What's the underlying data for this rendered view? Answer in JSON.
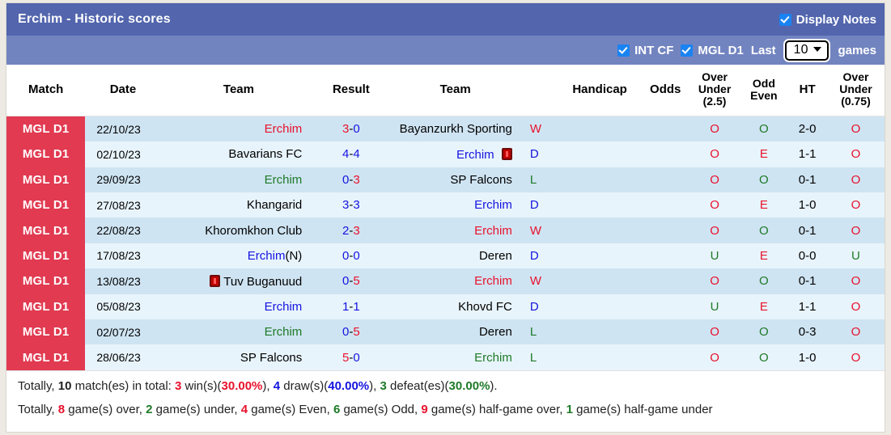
{
  "header": {
    "title": "Erchim - Historic scores",
    "display_notes_label": "Display Notes",
    "display_notes_checked": true,
    "filters": [
      {
        "label": "INT CF",
        "checked": true
      },
      {
        "label": "MGL D1",
        "checked": true
      }
    ],
    "last_label": "Last",
    "games_count": "10",
    "games_label": "games",
    "band_color": "#5265ad",
    "subband_color": "#7284c0",
    "checkbox_color": "#1a83f2"
  },
  "table": {
    "columns": [
      {
        "key": "match",
        "label": "Match"
      },
      {
        "key": "date",
        "label": "Date"
      },
      {
        "key": "home",
        "label": "Team"
      },
      {
        "key": "result",
        "label": "Result"
      },
      {
        "key": "away",
        "label": "Team"
      },
      {
        "key": "wdl",
        "label": ""
      },
      {
        "key": "handicap",
        "label": "Handicap"
      },
      {
        "key": "odds",
        "label": "Odds"
      },
      {
        "key": "ou25",
        "label": "Over Under (2.5)",
        "line1": "Over",
        "line2": "Under",
        "line3": "(2.5)"
      },
      {
        "key": "oddeven",
        "label": "Odd Even",
        "line1": "Odd",
        "line2": "Even"
      },
      {
        "key": "ht",
        "label": "HT"
      },
      {
        "key": "ou075",
        "label": "Over Under (0.75)",
        "line1": "Over",
        "line2": "Under",
        "line3": "(0.75)"
      }
    ],
    "rows": [
      {
        "league": "MGL D1",
        "date": "22/10/23",
        "home": "Erchim",
        "home_color": "#e8112d",
        "home_card": false,
        "home_suffix": "",
        "score_home": "3",
        "score_home_color": "#e8112d",
        "score_away": "0",
        "score_away_color": "#1414e0",
        "away": "Bayanzurkh Sporting",
        "away_color": "#000000",
        "away_card": false,
        "wdl": "W",
        "wdl_color": "#e8112d",
        "handicap": "",
        "odds": "",
        "ou25": "O",
        "ou25_color": "#e8112d",
        "oddeven": "O",
        "oddeven_color": "#1e7a28",
        "ht": "2-0",
        "ou075": "O",
        "ou075_color": "#e8112d"
      },
      {
        "league": "MGL D1",
        "date": "02/10/23",
        "home": "Bavarians FC",
        "home_color": "#000000",
        "home_card": false,
        "home_suffix": "",
        "score_home": "4",
        "score_home_color": "#1414e0",
        "score_away": "4",
        "score_away_color": "#1414e0",
        "away": "Erchim",
        "away_color": "#1414e0",
        "away_card": true,
        "wdl": "D",
        "wdl_color": "#1414e0",
        "handicap": "",
        "odds": "",
        "ou25": "O",
        "ou25_color": "#e8112d",
        "oddeven": "E",
        "oddeven_color": "#e8112d",
        "ht": "1-1",
        "ou075": "O",
        "ou075_color": "#e8112d"
      },
      {
        "league": "MGL D1",
        "date": "29/09/23",
        "home": "Erchim",
        "home_color": "#1e7a28",
        "home_card": false,
        "home_suffix": "",
        "score_home": "0",
        "score_home_color": "#1414e0",
        "score_away": "3",
        "score_away_color": "#e8112d",
        "away": "SP Falcons",
        "away_color": "#000000",
        "away_card": false,
        "wdl": "L",
        "wdl_color": "#1e7a28",
        "handicap": "",
        "odds": "",
        "ou25": "O",
        "ou25_color": "#e8112d",
        "oddeven": "O",
        "oddeven_color": "#1e7a28",
        "ht": "0-1",
        "ou075": "O",
        "ou075_color": "#e8112d"
      },
      {
        "league": "MGL D1",
        "date": "27/08/23",
        "home": "Khangarid",
        "home_color": "#000000",
        "home_card": false,
        "home_suffix": "",
        "score_home": "3",
        "score_home_color": "#1414e0",
        "score_away": "3",
        "score_away_color": "#1414e0",
        "away": "Erchim",
        "away_color": "#1414e0",
        "away_card": false,
        "wdl": "D",
        "wdl_color": "#1414e0",
        "handicap": "",
        "odds": "",
        "ou25": "O",
        "ou25_color": "#e8112d",
        "oddeven": "E",
        "oddeven_color": "#e8112d",
        "ht": "1-0",
        "ou075": "O",
        "ou075_color": "#e8112d"
      },
      {
        "league": "MGL D1",
        "date": "22/08/23",
        "home": "Khoromkhon Club",
        "home_color": "#000000",
        "home_card": false,
        "home_suffix": "",
        "score_home": "2",
        "score_home_color": "#1414e0",
        "score_away": "3",
        "score_away_color": "#e8112d",
        "away": "Erchim",
        "away_color": "#e8112d",
        "away_card": false,
        "wdl": "W",
        "wdl_color": "#e8112d",
        "handicap": "",
        "odds": "",
        "ou25": "O",
        "ou25_color": "#e8112d",
        "oddeven": "O",
        "oddeven_color": "#1e7a28",
        "ht": "0-1",
        "ou075": "O",
        "ou075_color": "#e8112d"
      },
      {
        "league": "MGL D1",
        "date": "17/08/23",
        "home": "Erchim",
        "home_color": "#1414e0",
        "home_card": false,
        "home_suffix": "(N)",
        "score_home": "0",
        "score_home_color": "#1414e0",
        "score_away": "0",
        "score_away_color": "#1414e0",
        "away": "Deren",
        "away_color": "#000000",
        "away_card": false,
        "wdl": "D",
        "wdl_color": "#1414e0",
        "handicap": "",
        "odds": "",
        "ou25": "U",
        "ou25_color": "#1e7a28",
        "oddeven": "E",
        "oddeven_color": "#e8112d",
        "ht": "0-0",
        "ou075": "U",
        "ou075_color": "#1e7a28"
      },
      {
        "league": "MGL D1",
        "date": "13/08/23",
        "home": "Tuv Buganuud",
        "home_color": "#000000",
        "home_card": true,
        "home_suffix": "",
        "score_home": "0",
        "score_home_color": "#1414e0",
        "score_away": "5",
        "score_away_color": "#e8112d",
        "away": "Erchim",
        "away_color": "#e8112d",
        "away_card": false,
        "wdl": "W",
        "wdl_color": "#e8112d",
        "handicap": "",
        "odds": "",
        "ou25": "O",
        "ou25_color": "#e8112d",
        "oddeven": "O",
        "oddeven_color": "#1e7a28",
        "ht": "0-1",
        "ou075": "O",
        "ou075_color": "#e8112d"
      },
      {
        "league": "MGL D1",
        "date": "05/08/23",
        "home": "Erchim",
        "home_color": "#1414e0",
        "home_card": false,
        "home_suffix": "",
        "score_home": "1",
        "score_home_color": "#1414e0",
        "score_away": "1",
        "score_away_color": "#1414e0",
        "away": "Khovd FC",
        "away_color": "#000000",
        "away_card": false,
        "wdl": "D",
        "wdl_color": "#1414e0",
        "handicap": "",
        "odds": "",
        "ou25": "U",
        "ou25_color": "#1e7a28",
        "oddeven": "E",
        "oddeven_color": "#e8112d",
        "ht": "1-1",
        "ou075": "O",
        "ou075_color": "#e8112d"
      },
      {
        "league": "MGL D1",
        "date": "02/07/23",
        "home": "Erchim",
        "home_color": "#1e7a28",
        "home_card": false,
        "home_suffix": "",
        "score_home": "0",
        "score_home_color": "#1414e0",
        "score_away": "5",
        "score_away_color": "#e8112d",
        "away": "Deren",
        "away_color": "#000000",
        "away_card": false,
        "wdl": "L",
        "wdl_color": "#1e7a28",
        "handicap": "",
        "odds": "",
        "ou25": "O",
        "ou25_color": "#e8112d",
        "oddeven": "O",
        "oddeven_color": "#1e7a28",
        "ht": "0-3",
        "ou075": "O",
        "ou075_color": "#e8112d"
      },
      {
        "league": "MGL D1",
        "date": "28/06/23",
        "home": "SP Falcons",
        "home_color": "#000000",
        "home_card": false,
        "home_suffix": "",
        "score_home": "5",
        "score_home_color": "#e8112d",
        "score_away": "0",
        "score_away_color": "#1414e0",
        "away": "Erchim",
        "away_color": "#1e7a28",
        "away_card": false,
        "wdl": "L",
        "wdl_color": "#1e7a28",
        "handicap": "",
        "odds": "",
        "ou25": "O",
        "ou25_color": "#e8112d",
        "oddeven": "O",
        "oddeven_color": "#1e7a28",
        "ht": "1-0",
        "ou075": "O",
        "ou075_color": "#e8112d"
      }
    ]
  },
  "summary": {
    "line1": {
      "prefix": "Totally,",
      "total": "10",
      "total_tail": "match(es) in total:",
      "wins": "3",
      "wins_word": "win(s)(",
      "wins_pct": "30.00%",
      "wins_close": "),",
      "draws": "4",
      "draws_word": "draw(s)(",
      "draws_pct": "40.00%",
      "draws_close": "),",
      "defeats": "3",
      "defeats_word": "defeat(es)(",
      "defeats_pct": "30.00%",
      "defeats_close": ")."
    },
    "line2": {
      "prefix": "Totally,",
      "over": "8",
      "over_word": "game(s) over,",
      "under": "2",
      "under_word": "game(s) under,",
      "even": "4",
      "even_word": "game(s) Even,",
      "odd": "6",
      "odd_word": "game(s) Odd,",
      "hg_over": "9",
      "hg_over_word": "game(s) half-game over,",
      "hg_under": "1",
      "hg_under_word": "game(s) half-game under"
    }
  }
}
